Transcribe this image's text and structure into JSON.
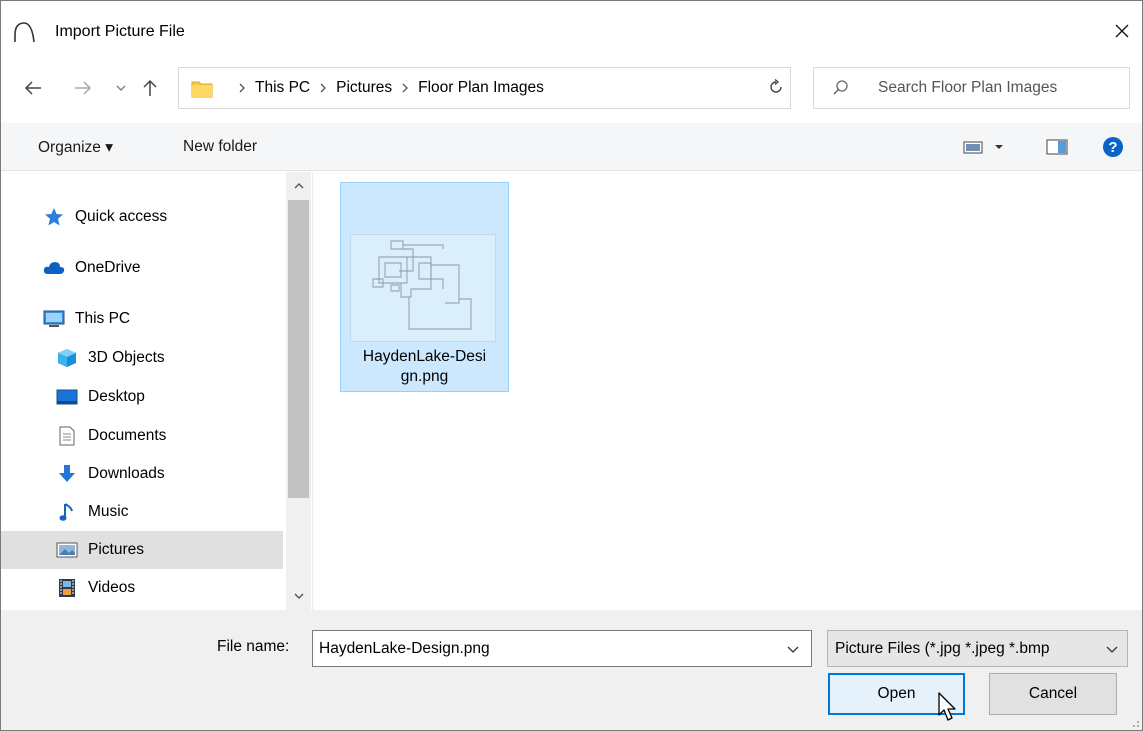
{
  "window": {
    "title": "Import Picture File",
    "close_icon": "close-icon",
    "app_icon": "arc-icon"
  },
  "navigation": {
    "back_icon": "arrow-left-icon",
    "forward_icon": "arrow-right-icon",
    "recent_icon": "chevron-down-icon",
    "up_icon": "arrow-up-icon",
    "breadcrumbs": [
      "This PC",
      "Pictures",
      "Floor Plan Images"
    ],
    "refresh_icon": "refresh-icon",
    "search_placeholder": "Search Floor Plan Images"
  },
  "toolbar": {
    "organize_label": "Organize ▾",
    "new_folder_label": "New folder",
    "view_icon": "view-options-icon",
    "preview_pane_icon": "preview-pane-icon",
    "help_icon": "help-icon",
    "help_glyph": "?"
  },
  "sidebar": {
    "items": [
      {
        "label": "Quick access",
        "icon": "star-icon"
      },
      {
        "label": "OneDrive",
        "icon": "cloud-icon"
      },
      {
        "label": "This PC",
        "icon": "computer-icon"
      },
      {
        "label": "3D Objects",
        "icon": "cube-icon"
      },
      {
        "label": "Desktop",
        "icon": "desktop-icon"
      },
      {
        "label": "Documents",
        "icon": "document-icon"
      },
      {
        "label": "Downloads",
        "icon": "download-icon"
      },
      {
        "label": "Music",
        "icon": "music-note-icon"
      },
      {
        "label": "Pictures",
        "icon": "pictures-icon",
        "selected": true
      },
      {
        "label": "Videos",
        "icon": "film-icon"
      }
    ]
  },
  "files": [
    {
      "name_line1": "HaydenLake-Desi",
      "name_line2": "gn.png",
      "selected": true
    }
  ],
  "bottom": {
    "file_name_label": "File name:",
    "file_name_value": "HaydenLake-Design.png",
    "filter_value": "Picture Files (*.jpg *.jpeg *.bmp",
    "open_label": "Open",
    "cancel_label": "Cancel"
  },
  "colors": {
    "selection": "#cce8ff",
    "accent": "#0078d7"
  }
}
